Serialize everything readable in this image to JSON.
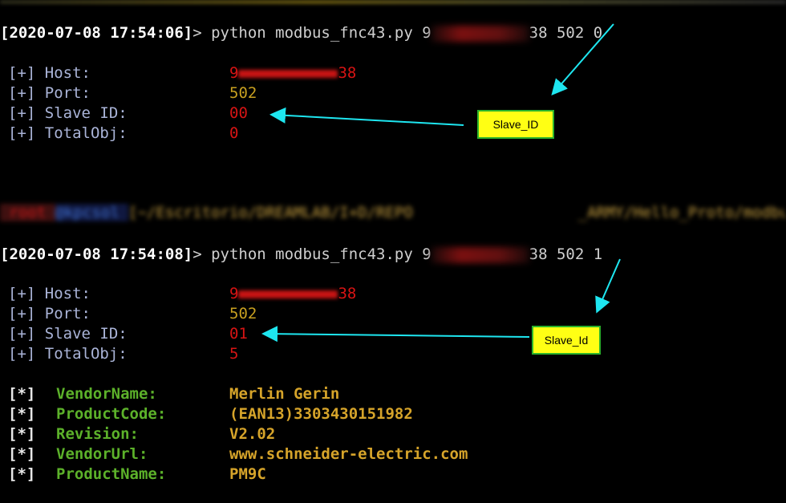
{
  "session1": {
    "prompt_timestamp": "[2020-07-08 17:54:06]",
    "prompt_symbol": ">",
    "command_prefix": " python modbus_fnc43.py 9",
    "command_suffix": "38 502 0",
    "rows": [
      {
        "label": "[+] Host:",
        "value_prefix": "9",
        "value_suffix": "38"
      },
      {
        "label": "[+] Port:",
        "value": "502"
      },
      {
        "label": "[+] Slave ID:",
        "value": "00"
      },
      {
        "label": "[+] TotalObj:",
        "value": "0"
      }
    ],
    "annotation": "Slave_ID"
  },
  "path_bar": {
    "seg1": " root ",
    "seg2": "@kpcsol ",
    "seg3": "[~/Escritorio/DREAMLAB/I+D/REPO                  _ARMY/Hello_Proto/modbus"
  },
  "session2": {
    "prompt_timestamp": "[2020-07-08 17:54:08]",
    "prompt_symbol": ">",
    "command_prefix": " python modbus_fnc43.py 9",
    "command_suffix": "38 502 1",
    "rows": [
      {
        "label": "[+] Host:",
        "value_prefix": "9",
        "value_suffix": "38"
      },
      {
        "label": "[+] Port:",
        "value": "502"
      },
      {
        "label": "[+] Slave ID:",
        "value": "01"
      },
      {
        "label": "[+] TotalObj:",
        "value": "5"
      }
    ],
    "annotation": "Slave_Id",
    "objects": [
      {
        "bracket": "[*]",
        "key": "VendorName:",
        "value": "Merlin Gerin"
      },
      {
        "bracket": "[*]",
        "key": "ProductCode:",
        "value": "(EAN13)3303430151982"
      },
      {
        "bracket": "[*]",
        "key": "Revision:",
        "value": "V2.02"
      },
      {
        "bracket": "[*]",
        "key": "VendorUrl:",
        "value": "www.schneider-electric.com"
      },
      {
        "bracket": "[*]",
        "key": "ProductName:",
        "value": "PM9C"
      }
    ]
  },
  "colors": {
    "background": "#000000",
    "host_red": "#d71414",
    "port_yellow": "#c8a020",
    "key_green": "#5cb12a",
    "value_gold": "#d6a42a",
    "annotation_fill": "#ffff14",
    "annotation_border": "#2bb42b",
    "arrow_cyan": "#1ee6f0"
  }
}
